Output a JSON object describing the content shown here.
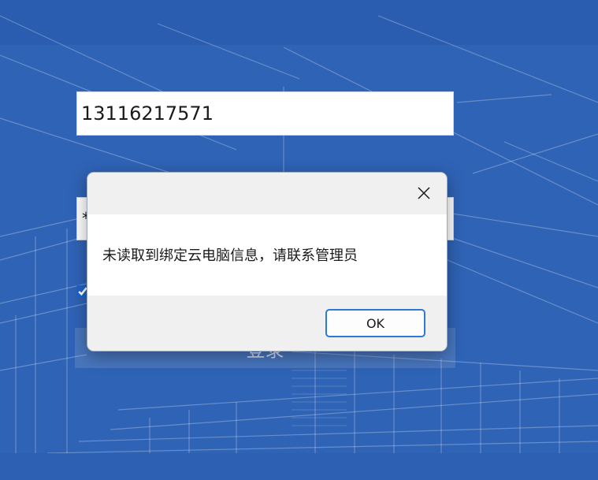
{
  "login": {
    "phone_value": "13116217571",
    "password_mask": "*",
    "remember_checked": true,
    "login_label": "登录"
  },
  "dialog": {
    "message": "未读取到绑定云电脑信息，请联系管理员",
    "ok_label": "OK",
    "close_icon": "close-icon"
  },
  "colors": {
    "background": "#2f63b6",
    "accent": "#2f78d4"
  }
}
